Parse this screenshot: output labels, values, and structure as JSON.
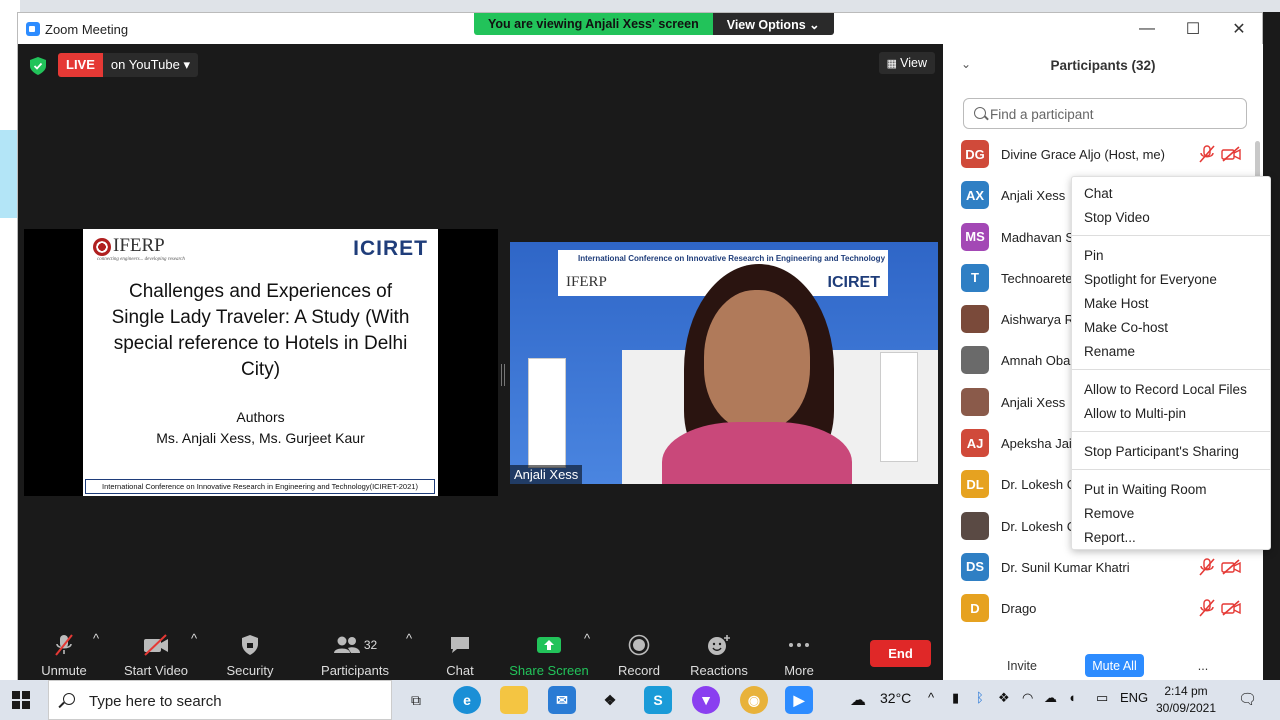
{
  "window": {
    "title": "Zoom Meeting",
    "banner_viewing": "You are viewing Anjali Xess' screen",
    "banner_options": "View Options ⌄",
    "minimize": "—",
    "maximize": "☐",
    "close": "✕"
  },
  "stage": {
    "live_label": "LIVE",
    "live_platform": "on YouTube ▾",
    "view_button": "View"
  },
  "slide": {
    "logo_left": "IFERP",
    "logo_left_tagline": "connecting engineers... developing research",
    "logo_right": "ICIRET",
    "title": "Challenges and Experiences of Single Lady Traveler: A Study (With special reference to Hotels in Delhi City)",
    "authors_heading": "Authors",
    "authors": "Ms. Anjali Xess, Ms. Gurjeet Kaur",
    "footer": "International Conference on Innovative Research in Engineering and Technology(ICIRET-2021)"
  },
  "camera": {
    "name_label": "Anjali Xess",
    "banner_text": "International Conference on Innovative Research in Engineering and Technology",
    "banner_logo_left": "IFERP",
    "banner_logo_right": "ICIRET"
  },
  "toolbar": {
    "unmute": "Unmute",
    "start_video": "Start Video",
    "security": "Security",
    "participants": "Participants",
    "participants_count": "32",
    "chat": "Chat",
    "share_screen": "Share Screen",
    "record": "Record",
    "reactions": "Reactions",
    "more": "More",
    "end": "End"
  },
  "participants_panel": {
    "title": "Participants (32)",
    "search_placeholder": "Find a participant",
    "invite": "Invite",
    "mute_all": "Mute All",
    "more": "...",
    "list": [
      {
        "initials": "DG",
        "name": "Divine Grace Aljo (Host, me)",
        "color": "#d04a3a"
      },
      {
        "initials": "AX",
        "name": "Anjali Xess",
        "color": "#2f7fc4"
      },
      {
        "initials": "MS",
        "name": "Madhavan S",
        "color": "#a348b5"
      },
      {
        "initials": "T",
        "name": "Technoarete",
        "color": "#2f7fc4"
      },
      {
        "initials": "",
        "name": "Aishwarya R",
        "color": "#7a4a3a"
      },
      {
        "initials": "",
        "name": "Amnah Oba",
        "color": "#6a6a6a"
      },
      {
        "initials": "",
        "name": "Anjali Xess",
        "color": "#8a5a4a"
      },
      {
        "initials": "AJ",
        "name": "Apeksha Jain",
        "color": "#d04a3a"
      },
      {
        "initials": "DL",
        "name": "Dr. Lokesh C",
        "color": "#e6a220"
      },
      {
        "initials": "",
        "name": "Dr. Lokesh C",
        "color": "#5a4a44"
      },
      {
        "initials": "DS",
        "name": "Dr. Sunil Kumar Khatri",
        "color": "#2f7fc4"
      },
      {
        "initials": "D",
        "name": "Drago",
        "color": "#e6a220"
      }
    ]
  },
  "context_menu": {
    "chat": "Chat",
    "stop_video": "Stop Video",
    "pin": "Pin",
    "spotlight": "Spotlight for Everyone",
    "make_host": "Make Host",
    "make_cohost": "Make Co-host",
    "rename": "Rename",
    "allow_record": "Allow to Record Local Files",
    "allow_multipin": "Allow to Multi-pin",
    "stop_sharing": "Stop Participant's Sharing",
    "waiting_room": "Put in Waiting Room",
    "remove": "Remove",
    "report": "Report..."
  },
  "taskbar": {
    "search_placeholder": "Type here to search",
    "temperature": "32°C",
    "language": "ENG",
    "time": "2:14 pm",
    "date": "30/09/2021"
  },
  "colors": {
    "accent": "#2d8cff",
    "live_red": "#e53935",
    "share_green": "#22c35a",
    "end_red": "#e02828"
  }
}
